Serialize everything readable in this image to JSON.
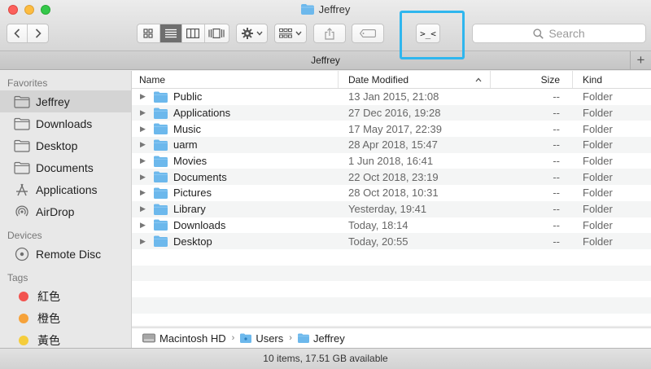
{
  "window": {
    "title": "Jeffrey"
  },
  "toolbar": {
    "search_placeholder": "Search",
    "terminal_label": ">_<"
  },
  "tab": {
    "title": "Jeffrey",
    "add_label": "+"
  },
  "sidebar": {
    "favorites_header": "Favorites",
    "favorites": [
      {
        "label": "Jeffrey",
        "icon": "home-folder-icon"
      },
      {
        "label": "Downloads",
        "icon": "folder-icon"
      },
      {
        "label": "Desktop",
        "icon": "folder-icon"
      },
      {
        "label": "Documents",
        "icon": "folder-icon"
      },
      {
        "label": "Applications",
        "icon": "applications-icon"
      },
      {
        "label": "AirDrop",
        "icon": "airdrop-icon"
      }
    ],
    "devices_header": "Devices",
    "devices": [
      {
        "label": "Remote Disc",
        "icon": "disc-icon"
      }
    ],
    "tags_header": "Tags",
    "tags": [
      {
        "label": "紅色",
        "color": "#f2534f"
      },
      {
        "label": "橙色",
        "color": "#f6a23a"
      },
      {
        "label": "黃色",
        "color": "#f5cd3c"
      }
    ]
  },
  "columns": {
    "name": "Name",
    "date": "Date Modified",
    "size": "Size",
    "kind": "Kind"
  },
  "files": [
    {
      "name": "Public",
      "date": "13 Jan 2015, 21:08",
      "size": "--",
      "kind": "Folder"
    },
    {
      "name": "Applications",
      "date": "27 Dec 2016, 19:28",
      "size": "--",
      "kind": "Folder"
    },
    {
      "name": "Music",
      "date": "17 May 2017, 22:39",
      "size": "--",
      "kind": "Folder"
    },
    {
      "name": "uarm",
      "date": "28 Apr 2018, 15:47",
      "size": "--",
      "kind": "Folder"
    },
    {
      "name": "Movies",
      "date": "1 Jun 2018, 16:41",
      "size": "--",
      "kind": "Folder"
    },
    {
      "name": "Documents",
      "date": "22 Oct 2018, 23:19",
      "size": "--",
      "kind": "Folder"
    },
    {
      "name": "Pictures",
      "date": "28 Oct 2018, 10:31",
      "size": "--",
      "kind": "Folder"
    },
    {
      "name": "Library",
      "date": "Yesterday, 19:41",
      "size": "--",
      "kind": "Folder"
    },
    {
      "name": "Downloads",
      "date": "Today, 18:14",
      "size": "--",
      "kind": "Folder"
    },
    {
      "name": "Desktop",
      "date": "Today, 20:55",
      "size": "--",
      "kind": "Folder"
    }
  ],
  "path": [
    "Macintosh HD",
    "Users",
    "Jeffrey"
  ],
  "status": "10 items, 17.51 GB available",
  "colors": {
    "folder_blue": "#6cb8ec",
    "highlight": "#2fb6ee"
  }
}
